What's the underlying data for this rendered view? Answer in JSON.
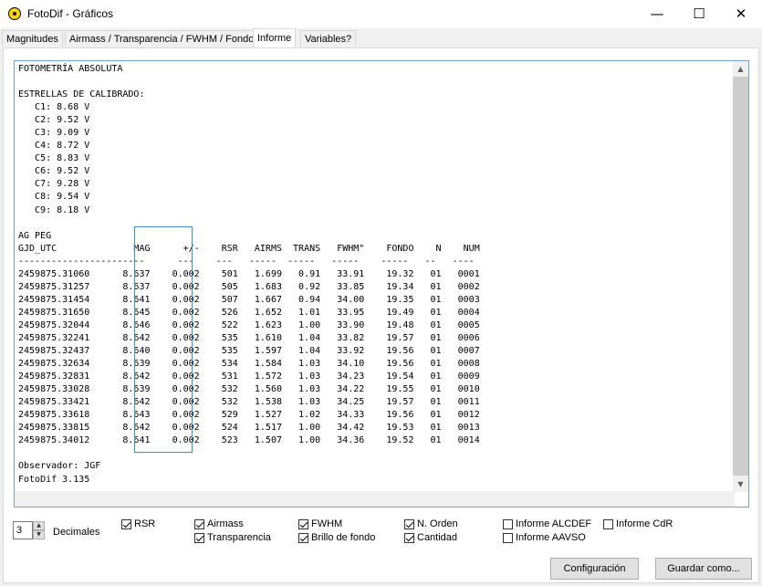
{
  "window": {
    "title": "FotoDif - Gráficos",
    "minimize": "—",
    "maximize": "☐",
    "close": "✕"
  },
  "tabs": [
    {
      "label": "Magnitudes",
      "active": false
    },
    {
      "label": "Airmass / Transparencia / FWHM / Fondo",
      "active": false
    },
    {
      "label": "Informe",
      "active": true
    },
    {
      "label": "Variables?",
      "active": false
    }
  ],
  "report": {
    "title": "FOTOMETRÍA ABSOLUTA",
    "calibration_header": "ESTRELLAS DE CALIBRADO:",
    "calibration_stars": [
      {
        "name": "C1",
        "mag": "8.68",
        "band": "V"
      },
      {
        "name": "C2",
        "mag": "9.52",
        "band": "V"
      },
      {
        "name": "C3",
        "mag": "9.09",
        "band": "V"
      },
      {
        "name": "C4",
        "mag": "8.72",
        "band": "V"
      },
      {
        "name": "C5",
        "mag": "8.83",
        "band": "V"
      },
      {
        "name": "C6",
        "mag": "9.52",
        "band": "V"
      },
      {
        "name": "C7",
        "mag": "9.28",
        "band": "V"
      },
      {
        "name": "C8",
        "mag": "9.54",
        "band": "V"
      },
      {
        "name": "C9",
        "mag": "8.18",
        "band": "V"
      }
    ],
    "target": "AG PEG",
    "columns": [
      "GJD_UTC",
      "MAG",
      "+/-",
      "RSR",
      "AIRMS",
      "TRANS",
      "FWHM\"",
      "FONDO",
      "N",
      "NUM"
    ],
    "rows": [
      [
        "2459875.31060",
        "8.637",
        "0.002",
        "501",
        "1.699",
        "0.91",
        "33.91",
        "19.32",
        "01",
        "0001"
      ],
      [
        "2459875.31257",
        "8.637",
        "0.002",
        "505",
        "1.683",
        "0.92",
        "33.85",
        "19.34",
        "01",
        "0002"
      ],
      [
        "2459875.31454",
        "8.641",
        "0.002",
        "507",
        "1.667",
        "0.94",
        "34.00",
        "19.35",
        "01",
        "0003"
      ],
      [
        "2459875.31650",
        "8.645",
        "0.002",
        "526",
        "1.652",
        "1.01",
        "33.95",
        "19.49",
        "01",
        "0004"
      ],
      [
        "2459875.32044",
        "8.646",
        "0.002",
        "522",
        "1.623",
        "1.00",
        "33.90",
        "19.48",
        "01",
        "0005"
      ],
      [
        "2459875.32241",
        "8.642",
        "0.002",
        "535",
        "1.610",
        "1.04",
        "33.82",
        "19.57",
        "01",
        "0006"
      ],
      [
        "2459875.32437",
        "8.640",
        "0.002",
        "535",
        "1.597",
        "1.04",
        "33.92",
        "19.56",
        "01",
        "0007"
      ],
      [
        "2459875.32634",
        "8.639",
        "0.002",
        "534",
        "1.584",
        "1.03",
        "34.10",
        "19.56",
        "01",
        "0008"
      ],
      [
        "2459875.32831",
        "8.642",
        "0.002",
        "531",
        "1.572",
        "1.03",
        "34.23",
        "19.54",
        "01",
        "0009"
      ],
      [
        "2459875.33028",
        "8.639",
        "0.002",
        "532",
        "1.560",
        "1.03",
        "34.22",
        "19.55",
        "01",
        "0010"
      ],
      [
        "2459875.33421",
        "8.642",
        "0.002",
        "532",
        "1.538",
        "1.03",
        "34.25",
        "19.57",
        "01",
        "0011"
      ],
      [
        "2459875.33618",
        "8.643",
        "0.002",
        "529",
        "1.527",
        "1.02",
        "34.33",
        "19.56",
        "01",
        "0012"
      ],
      [
        "2459875.33815",
        "8.642",
        "0.002",
        "524",
        "1.517",
        "1.00",
        "34.42",
        "19.53",
        "01",
        "0013"
      ],
      [
        "2459875.34012",
        "8.641",
        "0.002",
        "523",
        "1.507",
        "1.00",
        "34.36",
        "19.52",
        "01",
        "0014"
      ]
    ],
    "observer": "Observador: JGF",
    "software": "FotoDif 3.135"
  },
  "scrollbar": {
    "up": "▲",
    "down": "▼",
    "left": "◀",
    "right": "▶"
  },
  "controls": {
    "decimals_value": "3",
    "decimals_label": "Decimales",
    "spin_up": "▲",
    "spin_down": "▼",
    "checkboxes": [
      {
        "label": "RSR",
        "checked": true
      },
      {
        "label": "Airmass",
        "checked": true
      },
      {
        "label": "Transparencia",
        "checked": true
      },
      {
        "label": "FWHM",
        "checked": true
      },
      {
        "label": "Brillo de fondo",
        "checked": true
      },
      {
        "label": "N. Orden",
        "checked": true
      },
      {
        "label": "Cantidad",
        "checked": true
      },
      {
        "label": "Informe ALCDEF",
        "checked": false
      },
      {
        "label": "Informe AAVSO",
        "checked": false
      },
      {
        "label": "Informe CdR",
        "checked": false
      }
    ],
    "config_button": "Configuración",
    "save_button": "Guardar como..."
  }
}
